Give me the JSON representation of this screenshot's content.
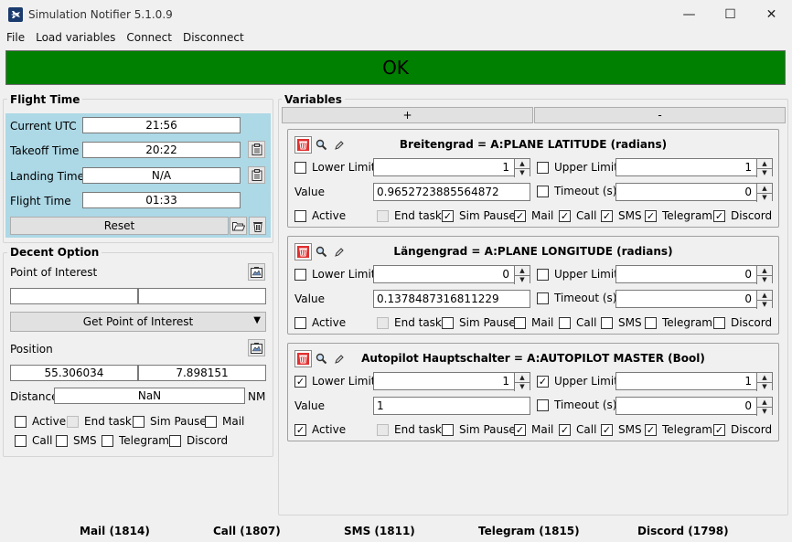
{
  "window": {
    "title": "Simulation Notifier 5.1.0.9",
    "minimize": "—",
    "maximize": "☐",
    "close": "✕"
  },
  "menu": [
    "File",
    "Load variables",
    "Connect",
    "Disconnect"
  ],
  "status": {
    "text": "OK",
    "color": "#008000"
  },
  "flight_time": {
    "title": "Flight Time",
    "current_utc_label": "Current UTC",
    "current_utc": "21:56",
    "takeoff_label": "Takeoff Time",
    "takeoff": "20:22",
    "landing_label": "Landing Time",
    "landing": "N/A",
    "flight_label": "Flight Time",
    "flight": "01:33",
    "reset_label": "Reset"
  },
  "decent": {
    "title": "Decent Option",
    "poi_label": "Point of Interest",
    "poi_field_1": "",
    "poi_field_2": "",
    "get_poi_label": "Get Point of Interest",
    "position_label": "Position",
    "lat": "55.306034",
    "lon": "7.898151",
    "distance_label": "Distance",
    "distance": "NaN",
    "distance_unit": "NM",
    "options": [
      {
        "label": "Active",
        "checked": false
      },
      {
        "label": "End task",
        "checked": false,
        "disabled": true
      },
      {
        "label": "Sim Pause",
        "checked": false
      },
      {
        "label": "Mail",
        "checked": false
      },
      {
        "label": "Call",
        "checked": false
      },
      {
        "label": "SMS",
        "checked": false
      },
      {
        "label": "Telegram",
        "checked": false
      },
      {
        "label": "Discord",
        "checked": false
      }
    ]
  },
  "variables": {
    "title": "Variables",
    "add_label": "+",
    "remove_label": "-",
    "lower_label": "Lower Limit",
    "upper_label": "Upper Limit",
    "value_label": "Value",
    "timeout_label": "Timeout (s)",
    "items": [
      {
        "title": "Breitengrad = A:PLANE LATITUDE (radians)",
        "lower_checked": false,
        "lower": "1",
        "upper_checked": false,
        "upper": "1",
        "value": "0.9652723885564872",
        "timeout_checked": false,
        "timeout": "0",
        "flags": [
          false,
          false,
          true,
          true,
          true,
          true,
          true,
          true
        ]
      },
      {
        "title": "Längengrad = A:PLANE LONGITUDE (radians)",
        "lower_checked": false,
        "lower": "0",
        "upper_checked": false,
        "upper": "0",
        "value": "0.1378487316811229",
        "timeout_checked": false,
        "timeout": "0",
        "flags": [
          false,
          false,
          false,
          false,
          false,
          false,
          false,
          false
        ]
      },
      {
        "title": "Autopilot Hauptschalter = A:AUTOPILOT MASTER (Bool)",
        "lower_checked": true,
        "lower": "1",
        "upper_checked": true,
        "upper": "1",
        "value": "1",
        "timeout_checked": false,
        "timeout": "0",
        "flags": [
          true,
          false,
          false,
          true,
          true,
          true,
          true,
          true
        ]
      }
    ],
    "flag_labels": [
      "Active",
      "End task",
      "Sim Pause",
      "Mail",
      "Call",
      "SMS",
      "Telegram",
      "Discord"
    ]
  },
  "footer": {
    "mail": "Mail (1814)",
    "call": "Call (1807)",
    "sms": "SMS (1811)",
    "telegram": "Telegram (1815)",
    "discord": "Discord (1798)"
  }
}
